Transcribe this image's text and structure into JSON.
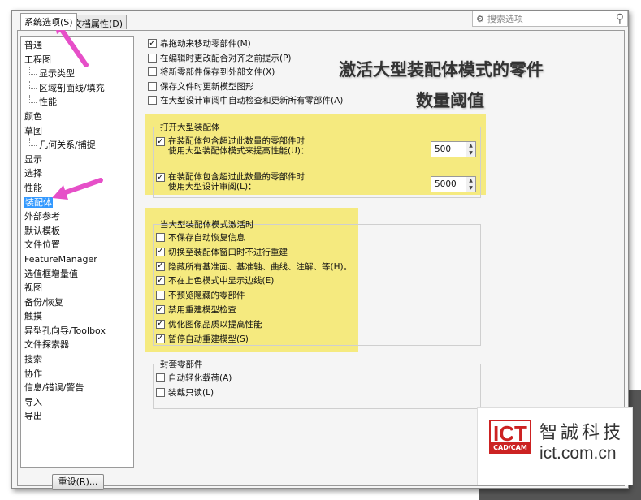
{
  "tabs": [
    {
      "label": "系统选项(S)"
    },
    {
      "label": "文档属性(D)"
    }
  ],
  "search": {
    "placeholder": "搜索选项"
  },
  "tree": {
    "items": [
      {
        "label": "普通",
        "sub": false
      },
      {
        "label": "工程图",
        "sub": false
      },
      {
        "label": "显示类型",
        "sub": true
      },
      {
        "label": "区域剖面线/填充",
        "sub": true
      },
      {
        "label": "性能",
        "sub": true
      },
      {
        "label": "颜色",
        "sub": false
      },
      {
        "label": "草图",
        "sub": false
      },
      {
        "label": "几何关系/捕捉",
        "sub": true
      },
      {
        "label": "显示",
        "sub": false
      },
      {
        "label": "选择",
        "sub": false
      },
      {
        "label": "性能",
        "sub": false
      },
      {
        "label": "装配体",
        "sub": false,
        "selected": true
      },
      {
        "label": "外部参考",
        "sub": false
      },
      {
        "label": "默认模板",
        "sub": false
      },
      {
        "label": "文件位置",
        "sub": false
      },
      {
        "label": "FeatureManager",
        "sub": false
      },
      {
        "label": "选值框增量值",
        "sub": false
      },
      {
        "label": "视图",
        "sub": false
      },
      {
        "label": "备份/恢复",
        "sub": false
      },
      {
        "label": "触摸",
        "sub": false
      },
      {
        "label": "异型孔向导/Toolbox",
        "sub": false
      },
      {
        "label": "文件探索器",
        "sub": false
      },
      {
        "label": "搜索",
        "sub": false
      },
      {
        "label": "协作",
        "sub": false
      },
      {
        "label": "信息/错误/警告",
        "sub": false
      },
      {
        "label": "导入",
        "sub": false
      },
      {
        "label": "导出",
        "sub": false
      }
    ]
  },
  "reset_button": "重设(R)...",
  "top_options": [
    {
      "label": "靠拖动来移动零部件(M)",
      "checked": true
    },
    {
      "label": "在编辑时更改配合对齐之前提示(P)",
      "checked": false
    },
    {
      "label": "将新零部件保存到外部文件(X)",
      "checked": false
    },
    {
      "label": "保存文件时更新模型图形",
      "checked": false
    },
    {
      "label": "在大型设计审阅中自动检查和更新所有零部件(A)",
      "checked": false
    }
  ],
  "large_open": {
    "title": "打开大型装配体",
    "opt1": {
      "line1": "在装配体包含超过此数量的零部件时",
      "line2": "使用大型装配体模式来提高性能(U)：",
      "checked": true,
      "value": "500"
    },
    "opt2": {
      "line1": "在装配体包含超过此数量的零部件时",
      "line2": "使用大型设计审阅(L)：",
      "checked": true,
      "value": "5000"
    }
  },
  "large_mode": {
    "title": "当大型装配体模式激活时",
    "options": [
      {
        "label": "不保存自动恢复信息",
        "checked": false
      },
      {
        "label": "切换至装配体窗口时不进行重建",
        "checked": true
      },
      {
        "label": "隐藏所有基准面、基准轴、曲线、注解、等(H)。",
        "checked": true
      },
      {
        "label": "不在上色模式中显示边线(E)",
        "checked": true
      },
      {
        "label": "不预览隐藏的零部件",
        "checked": false
      },
      {
        "label": "禁用重建模型检查",
        "checked": true
      },
      {
        "label": "优化图像品质以提高性能",
        "checked": true
      },
      {
        "label": "暂停自动重建模型(S)",
        "checked": true
      }
    ]
  },
  "envelope": {
    "title": "封套零部件",
    "options": [
      {
        "label": "自动轻化载荷(A)",
        "checked": false
      },
      {
        "label": "装载只读(L)",
        "checked": false
      }
    ]
  },
  "annotation": {
    "line1": "激活大型装配体模式的零件",
    "line2": "数量阈值"
  },
  "logo": {
    "ict": "ICT",
    "cadcam": "CAD/CAM",
    "cn": "智誠科技",
    "url": "ict.com.cn"
  },
  "colors": {
    "highlight": "#f5e86a",
    "arrow": "#e64fc8",
    "selected": "#3399ff",
    "logo_red": "#cc2222"
  }
}
